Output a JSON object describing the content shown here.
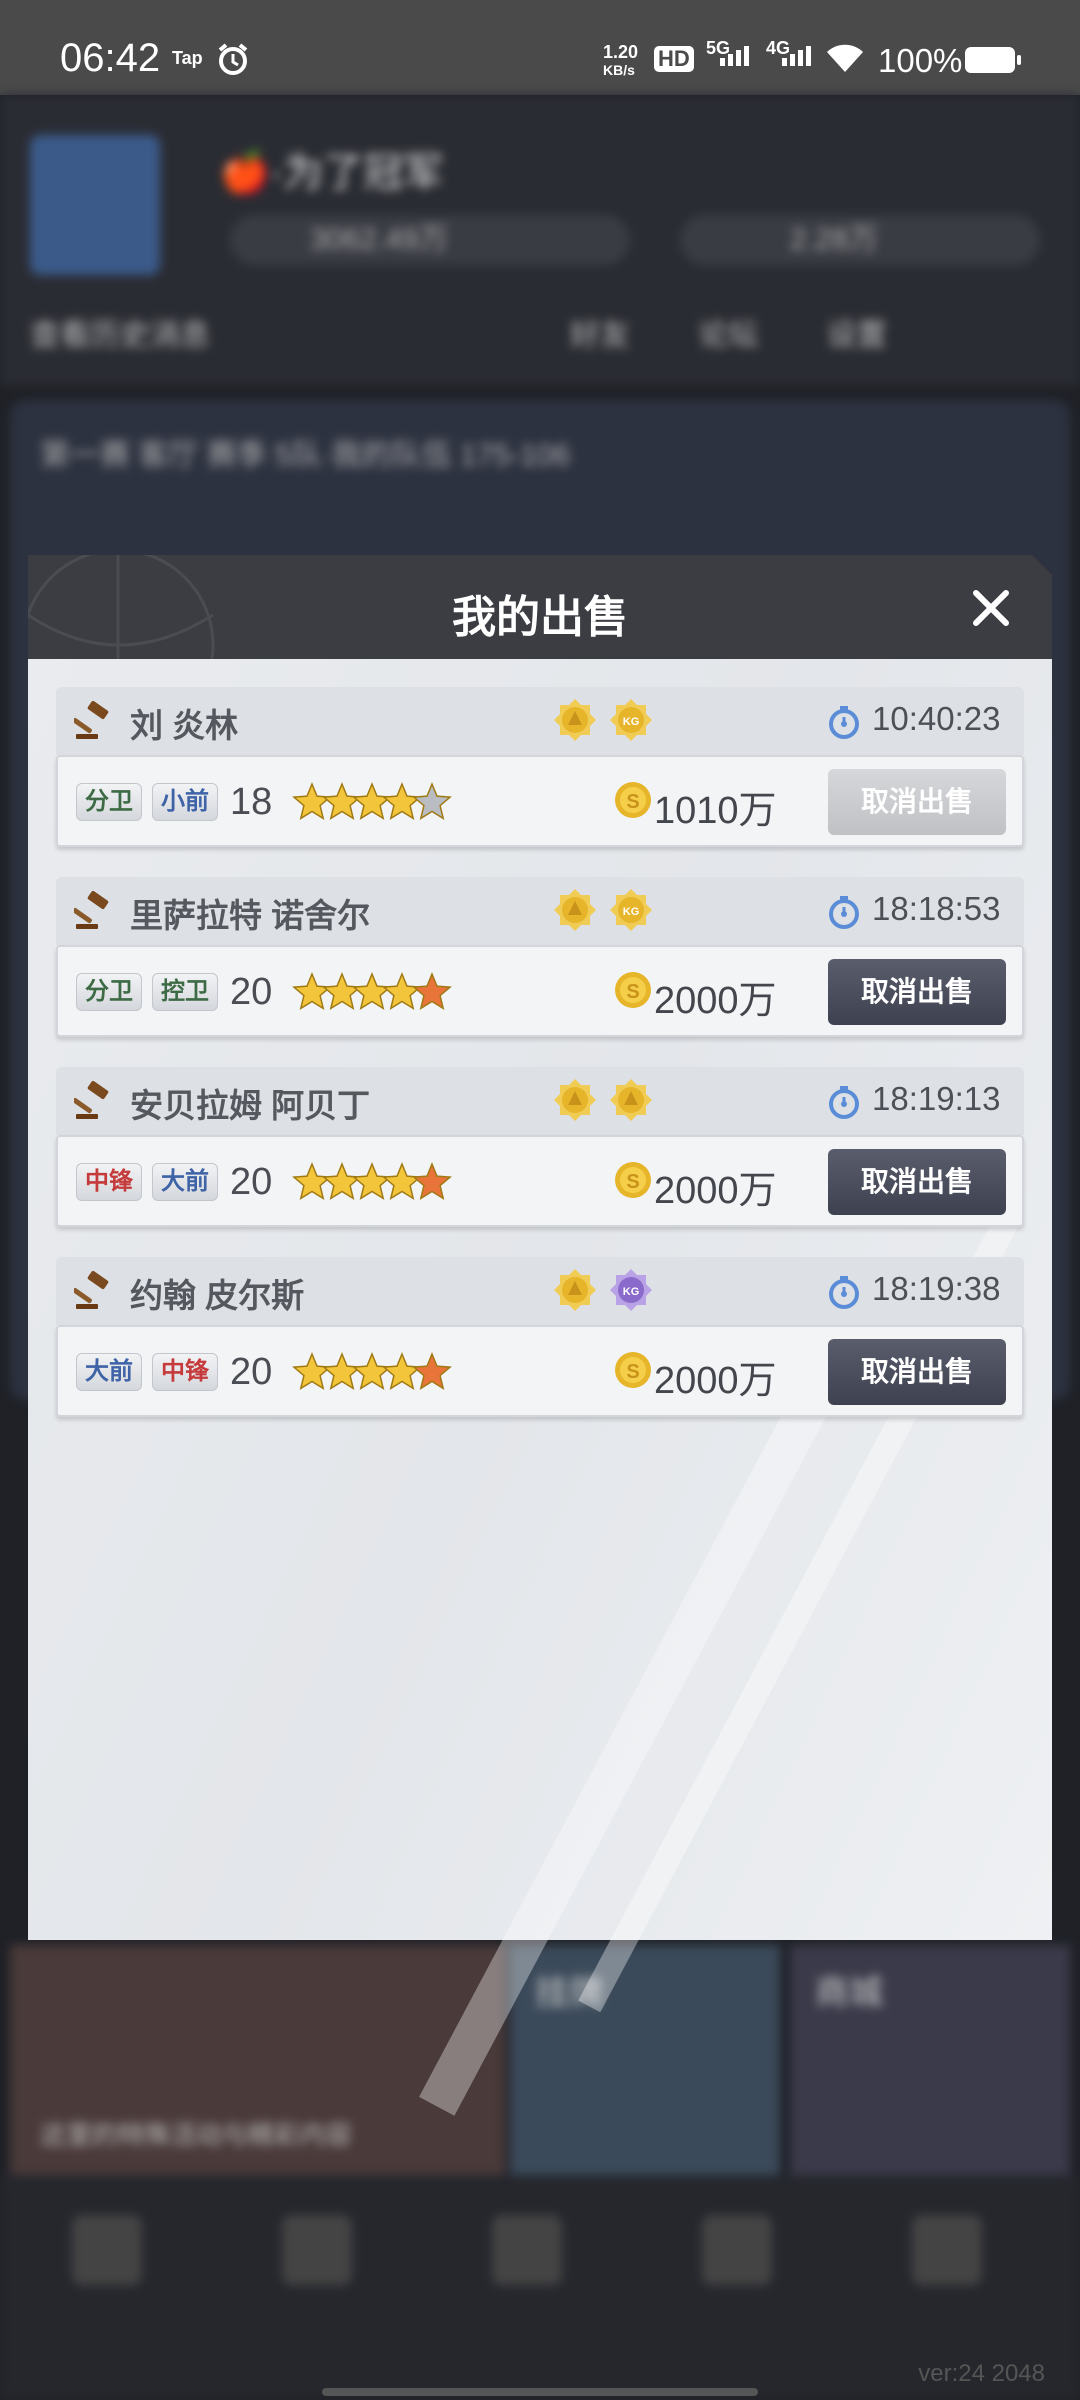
{
  "status_bar": {
    "time": "06:42",
    "tap_label": "Tap",
    "net_speed_top": "1.20",
    "net_speed_unit": "KB/s",
    "hd_label": "HD",
    "sim1": "5G",
    "sim2": "4G",
    "battery_pct": "100%"
  },
  "background": {
    "nickname": "🍎·为了冠军",
    "coins": "3062.49万",
    "gems": "2.28万",
    "sub_left": "查看历史消息",
    "sub_right": "好友 论坛 设置",
    "court_row": "第一赛 客厅 赛季 5队·我的队伍 175-106",
    "card_caption": "这里的特殊活动与精彩内容",
    "card2": "挂牌",
    "card3": "商城",
    "version": "ver:24  2048"
  },
  "modal": {
    "title": "我的出售",
    "listings": [
      {
        "name": "刘 炎林",
        "timer": "10:40:23",
        "pos1": "分卫",
        "pos2": "小前",
        "level": "18",
        "stars": 4,
        "price": "1010万",
        "button": "取消出售",
        "button_state": "disabled"
      },
      {
        "name": "里萨拉特 诺舍尔",
        "timer": "18:18:53",
        "pos1": "分卫",
        "pos2": "控卫",
        "level": "20",
        "stars": 5,
        "price": "2000万",
        "button": "取消出售",
        "button_state": "enabled"
      },
      {
        "name": "安贝拉姆 阿贝丁",
        "timer": "18:19:13",
        "pos1": "中锋",
        "pos2": "大前",
        "level": "20",
        "stars": 5,
        "price": "2000万",
        "button": "取消出售",
        "button_state": "enabled"
      },
      {
        "name": "约翰 皮尔斯",
        "timer": "18:19:38",
        "pos1": "大前",
        "pos2": "中锋",
        "level": "20",
        "stars": 5,
        "price": "2000万",
        "button": "取消出售",
        "button_state": "enabled"
      }
    ],
    "badge_text": "KG"
  },
  "colors": {
    "modal_header": "#3b3d43",
    "button_dark": "#4a4d5c",
    "button_disabled": "#c8cacd",
    "gold": "#e6b52a",
    "timer_blue": "#5b8cd8"
  }
}
